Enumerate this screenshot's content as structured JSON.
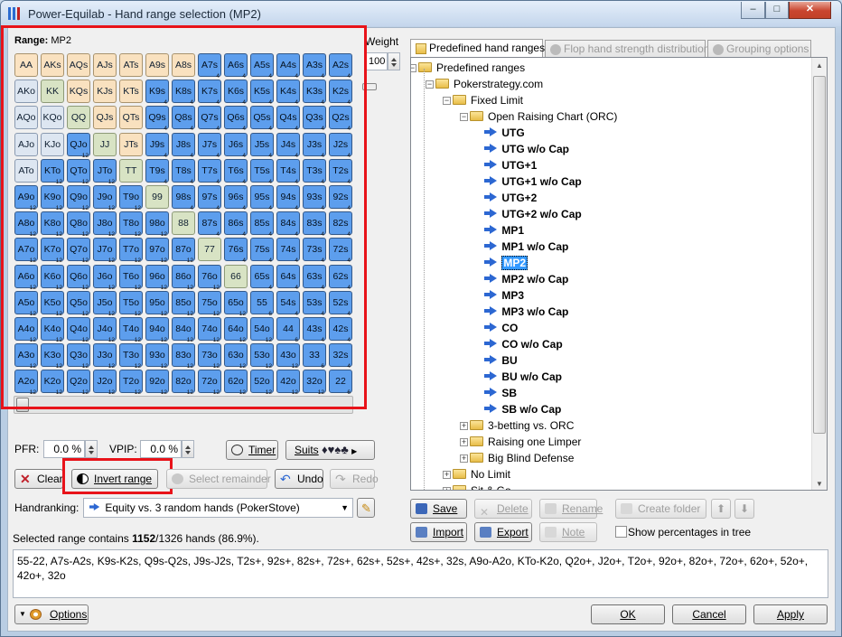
{
  "window": {
    "title": "Power-Equilab - Hand range selection (MP2)",
    "controls": [
      "–",
      "□",
      "✕"
    ]
  },
  "range": {
    "label": "Range:",
    "name": "MP2",
    "weight_label": "Weight",
    "weight_value": "100"
  },
  "grid": {
    "rows": [
      [
        "AA",
        "AKs",
        "AQs",
        "AJs",
        "ATs",
        "A9s",
        "A8s",
        "A7s",
        "A6s",
        "A5s",
        "A4s",
        "A3s",
        "A2s"
      ],
      [
        "AKo",
        "KK",
        "KQs",
        "KJs",
        "KTs",
        "K9s",
        "K8s",
        "K7s",
        "K6s",
        "K5s",
        "K4s",
        "K3s",
        "K2s"
      ],
      [
        "AQo",
        "KQo",
        "QQ",
        "QJs",
        "QTs",
        "Q9s",
        "Q8s",
        "Q7s",
        "Q6s",
        "Q5s",
        "Q4s",
        "Q3s",
        "Q2s"
      ],
      [
        "AJo",
        "KJo",
        "QJo",
        "JJ",
        "JTs",
        "J9s",
        "J8s",
        "J7s",
        "J6s",
        "J5s",
        "J4s",
        "J3s",
        "J2s"
      ],
      [
        "ATo",
        "KTo",
        "QTo",
        "JTo",
        "TT",
        "T9s",
        "T8s",
        "T7s",
        "T6s",
        "T5s",
        "T4s",
        "T3s",
        "T2s"
      ],
      [
        "A9o",
        "K9o",
        "Q9o",
        "J9o",
        "T9o",
        "99",
        "98s",
        "97s",
        "96s",
        "95s",
        "94s",
        "93s",
        "92s"
      ],
      [
        "A8o",
        "K8o",
        "Q8o",
        "J8o",
        "T8o",
        "98o",
        "88",
        "87s",
        "86s",
        "85s",
        "84s",
        "83s",
        "82s"
      ],
      [
        "A7o",
        "K7o",
        "Q7o",
        "J7o",
        "T7o",
        "97o",
        "87o",
        "77",
        "76s",
        "75s",
        "74s",
        "73s",
        "72s"
      ],
      [
        "A6o",
        "K6o",
        "Q6o",
        "J6o",
        "T6o",
        "96o",
        "86o",
        "76o",
        "66",
        "65s",
        "64s",
        "63s",
        "62s"
      ],
      [
        "A5o",
        "K5o",
        "Q5o",
        "J5o",
        "T5o",
        "95o",
        "85o",
        "75o",
        "65o",
        "55",
        "54s",
        "53s",
        "52s"
      ],
      [
        "A4o",
        "K4o",
        "Q4o",
        "J4o",
        "T4o",
        "94o",
        "84o",
        "74o",
        "64o",
        "54o",
        "44",
        "43s",
        "42s"
      ],
      [
        "A3o",
        "K3o",
        "Q3o",
        "J3o",
        "T3o",
        "93o",
        "83o",
        "73o",
        "63o",
        "53o",
        "43o",
        "33",
        "32s"
      ],
      [
        "A2o",
        "K2o",
        "Q2o",
        "J2o",
        "T2o",
        "92o",
        "82o",
        "72o",
        "62o",
        "52o",
        "42o",
        "32o",
        "22"
      ]
    ],
    "selected_rows": [
      [
        0,
        0,
        0,
        0,
        0,
        0,
        0,
        1,
        1,
        1,
        1,
        1,
        1
      ],
      [
        0,
        0,
        0,
        0,
        0,
        1,
        1,
        1,
        1,
        1,
        1,
        1,
        1
      ],
      [
        0,
        0,
        0,
        0,
        0,
        1,
        1,
        1,
        1,
        1,
        1,
        1,
        1
      ],
      [
        0,
        0,
        1,
        0,
        0,
        1,
        1,
        1,
        1,
        1,
        1,
        1,
        1
      ],
      [
        0,
        1,
        1,
        1,
        0,
        1,
        1,
        1,
        1,
        1,
        1,
        1,
        1
      ],
      [
        1,
        1,
        1,
        1,
        1,
        0,
        1,
        1,
        1,
        1,
        1,
        1,
        1
      ],
      [
        1,
        1,
        1,
        1,
        1,
        1,
        0,
        1,
        1,
        1,
        1,
        1,
        1
      ],
      [
        1,
        1,
        1,
        1,
        1,
        1,
        1,
        0,
        1,
        1,
        1,
        1,
        1
      ],
      [
        1,
        1,
        1,
        1,
        1,
        1,
        1,
        1,
        0,
        1,
        1,
        1,
        1
      ],
      [
        1,
        1,
        1,
        1,
        1,
        1,
        1,
        1,
        1,
        1,
        1,
        1,
        1
      ],
      [
        1,
        1,
        1,
        1,
        1,
        1,
        1,
        1,
        1,
        1,
        1,
        1,
        1
      ],
      [
        1,
        1,
        1,
        1,
        1,
        1,
        1,
        1,
        1,
        1,
        1,
        1,
        1
      ],
      [
        1,
        1,
        1,
        1,
        1,
        1,
        1,
        1,
        1,
        1,
        1,
        1,
        1
      ]
    ]
  },
  "stats": {
    "pfr_label": "PFR:",
    "pfr_value": "0.0 %",
    "vpip_label": "VPIP:",
    "vpip_value": "0.0 %"
  },
  "buttons": {
    "timer": "Timer",
    "suits": "Suits",
    "suits_glyphs": "♦♥♠♣",
    "clear": "Clear",
    "invert": "Invert range",
    "select_remainder": "Select remainder",
    "undo": "Undo",
    "redo": "Redo",
    "options": "Options",
    "ok": "OK",
    "cancel": "Cancel",
    "apply": "Apply"
  },
  "handranking": {
    "label": "Handranking:",
    "value": "Equity vs. 3 random hands (PokerStove)"
  },
  "selection_summary": {
    "prefix": "Selected range contains ",
    "count": "1152",
    "suffix": "/1326 hands (86.9%)."
  },
  "range_text": "55-22, A7s-A2s, K9s-K2s, Q9s-Q2s, J9s-J2s, T2s+, 92s+, 82s+, 72s+, 62s+, 52s+, 42s+, 32s, A9o-A2o, KTo-K2o, Q2o+, J2o+, T2o+, 92o+, 82o+, 72o+, 62o+, 52o+, 42o+, 32o",
  "tabs": [
    "Predefined hand ranges",
    "Flop hand strength distribution",
    "Grouping options"
  ],
  "tree": {
    "root": "Predefined ranges",
    "site": "Pokerstrategy.com",
    "limit": "Fixed Limit",
    "chart": "Open Raising Chart (ORC)",
    "items": [
      "UTG",
      "UTG w/o Cap",
      "UTG+1",
      "UTG+1 w/o Cap",
      "UTG+2",
      "UTG+2 w/o Cap",
      "MP1",
      "MP1 w/o Cap",
      "MP2",
      "MP2 w/o Cap",
      "MP3",
      "MP3 w/o Cap",
      "CO",
      "CO w/o Cap",
      "BU",
      "BU w/o Cap",
      "SB",
      "SB w/o Cap"
    ],
    "selected": "MP2",
    "more": [
      "3-betting vs. ORC",
      "Raising one Limper",
      "Big Blind Defense"
    ],
    "no_limit": "No Limit",
    "sit_go": "Sit & Go"
  },
  "tree_buttons": {
    "save": "Save",
    "delete": "Delete",
    "rename": "Rename",
    "create_folder": "Create folder",
    "import": "Import",
    "export": "Export",
    "note": "Note",
    "show_pct": "Show percentages in tree"
  },
  "colors": {
    "selected": "#5d9eed",
    "pair": "#d8e3c4",
    "suited": "#fbe3c2",
    "offsuit": "#dde6f1",
    "highlight": "#e8131a"
  }
}
